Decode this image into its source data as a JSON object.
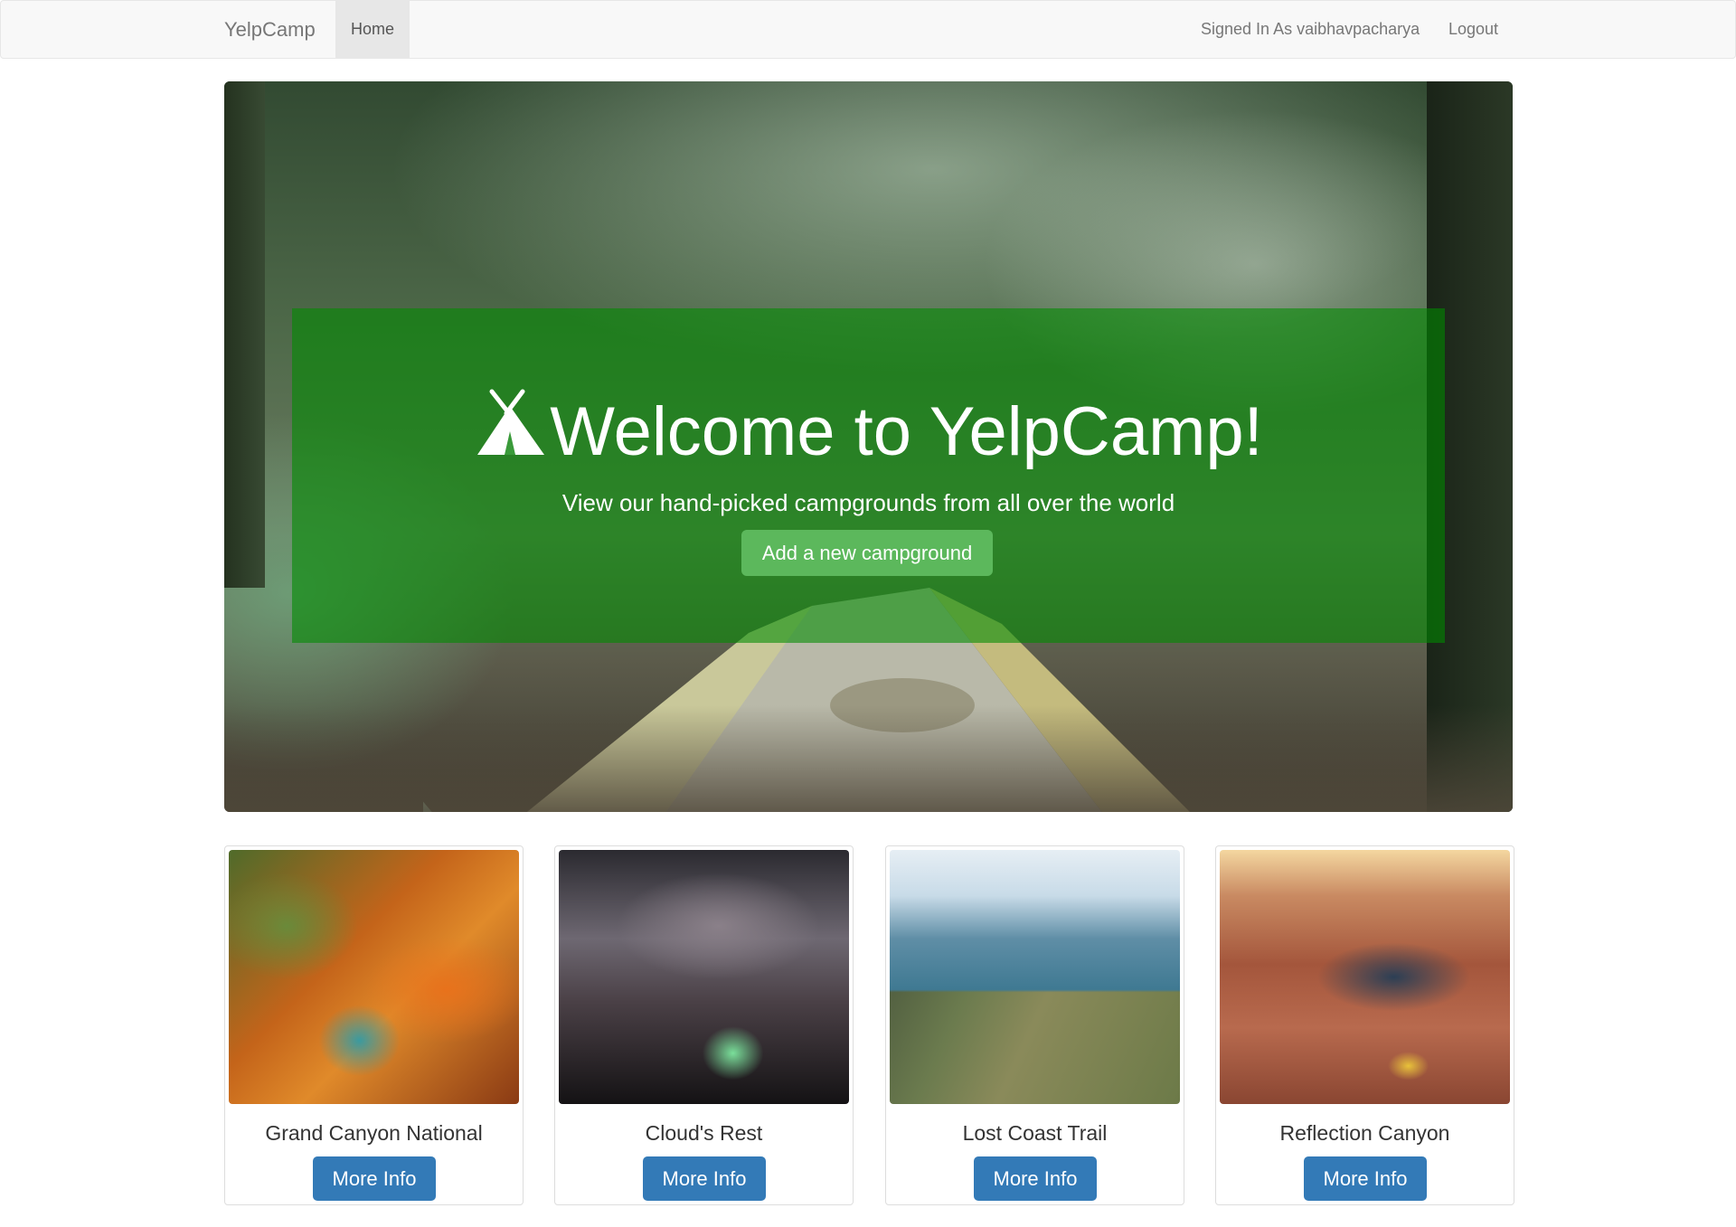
{
  "navbar": {
    "brand": "YelpCamp",
    "home": "Home",
    "signed_in": "Signed In As vaibhavpacharya",
    "logout": "Logout"
  },
  "hero": {
    "title": "Welcome to YelpCamp!",
    "subtitle": "View our hand-picked campgrounds from all over the world",
    "add_button": "Add a new campground"
  },
  "campgrounds": [
    {
      "name": "Grand Canyon National",
      "button": "More Info"
    },
    {
      "name": "Cloud's Rest",
      "button": "More Info"
    },
    {
      "name": "Lost Coast Trail",
      "button": "More Info"
    },
    {
      "name": "Reflection Canyon",
      "button": "More Info"
    }
  ],
  "colors": {
    "hero_overlay": "#008c00",
    "add_button": "#5cb85c",
    "info_button": "#337ab7",
    "navbar_bg": "#f8f8f8"
  }
}
